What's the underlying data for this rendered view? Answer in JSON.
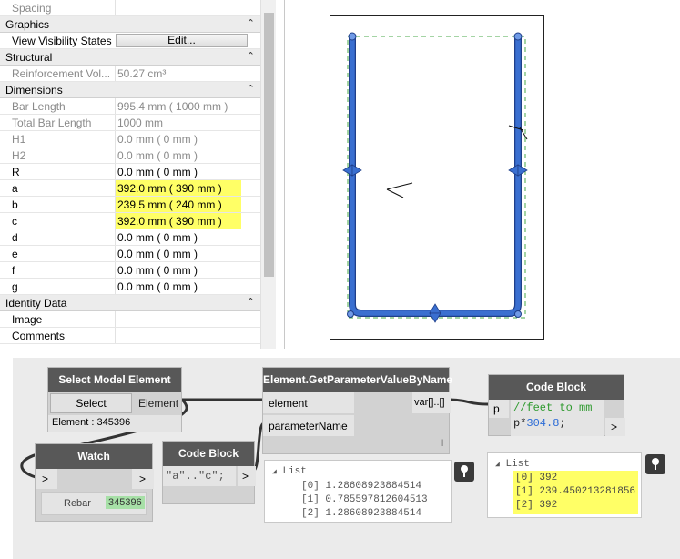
{
  "properties": {
    "rows": [
      {
        "kind": "row",
        "name": "Spacing",
        "value": "",
        "readonly": true
      },
      {
        "kind": "section",
        "name": "Graphics"
      },
      {
        "kind": "button-row",
        "name": "View Visibility States",
        "button": "Edit..."
      },
      {
        "kind": "section",
        "name": "Structural"
      },
      {
        "kind": "row",
        "name": "Reinforcement Vol...",
        "value": "50.27 cm³",
        "readonly": true
      },
      {
        "kind": "section",
        "name": "Dimensions"
      },
      {
        "kind": "row",
        "name": "Bar Length",
        "value": "995.4 mm ( 1000 mm )",
        "readonly": true
      },
      {
        "kind": "row",
        "name": "Total Bar Length",
        "value": "1000 mm",
        "readonly": true
      },
      {
        "kind": "row",
        "name": "H1",
        "value": "0.0 mm ( 0 mm )",
        "readonly": true
      },
      {
        "kind": "row",
        "name": "H2",
        "value": "0.0 mm ( 0 mm )",
        "readonly": true
      },
      {
        "kind": "row",
        "name": "R",
        "value": "0.0 mm ( 0 mm )",
        "readonly": false
      },
      {
        "kind": "row",
        "name": "a",
        "value": "392.0 mm ( 390 mm )",
        "readonly": false,
        "highlight": true
      },
      {
        "kind": "row",
        "name": "b",
        "value": "239.5 mm ( 240 mm )",
        "readonly": false,
        "highlight": true
      },
      {
        "kind": "row",
        "name": "c",
        "value": "392.0 mm ( 390 mm )",
        "readonly": false,
        "highlight": true
      },
      {
        "kind": "row",
        "name": "d",
        "value": "0.0 mm ( 0 mm )",
        "readonly": false
      },
      {
        "kind": "row",
        "name": "e",
        "value": "0.0 mm ( 0 mm )",
        "readonly": false
      },
      {
        "kind": "row",
        "name": "f",
        "value": "0.0 mm ( 0 mm )",
        "readonly": false
      },
      {
        "kind": "row",
        "name": "g",
        "value": "0.0 mm ( 0 mm )",
        "readonly": false
      },
      {
        "kind": "section",
        "name": "Identity Data"
      },
      {
        "kind": "row",
        "name": "Image",
        "value": "",
        "readonly": false
      },
      {
        "kind": "row",
        "name": "Comments",
        "value": "",
        "readonly": false
      }
    ],
    "collapse_glyph": "⌃"
  },
  "dynamo": {
    "select_node": {
      "title": "Select Model Element",
      "button": "Select",
      "output": "Element",
      "info": "Element : 345396"
    },
    "getparam_node": {
      "title": "Element.GetParameterValueByName",
      "in1": "element",
      "in2": "parameterName",
      "out": "var[]..[]",
      "lacing": "l"
    },
    "watch_node": {
      "title": "Watch",
      "in": ">",
      "out": ">",
      "item_label": "Rebar",
      "item_value": "345396"
    },
    "code_node_1": {
      "title": "Code Block",
      "code": "\"a\"..\"c\";",
      "out": ">"
    },
    "code_node_2": {
      "title": "Code Block",
      "port": "p",
      "comment": "//feet to mm",
      "expr_var": "p*",
      "expr_num": "304.8",
      "expr_end": ";",
      "out": ">"
    },
    "preview_1": {
      "header": "List",
      "items": [
        "[0] 1.28608923884514",
        "[1] 0.785597812604513",
        "[2] 1.28608923884514"
      ]
    },
    "preview_2": {
      "header": "List",
      "items": [
        "[0] 392",
        "[1] 239.450213281856",
        "[2] 392"
      ]
    }
  },
  "colors": {
    "highlight": "#ffff66",
    "rebar": "#3a6fd0",
    "node_header": "#585858",
    "watch_value_bg": "#a7e0a7",
    "code_green": "#2e9a2e",
    "code_blue": "#2b6bd6"
  }
}
